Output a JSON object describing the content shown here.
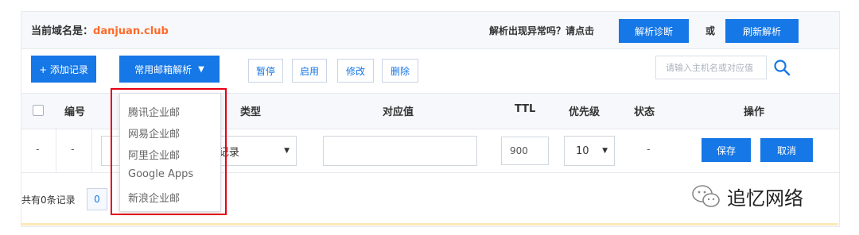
{
  "header": {
    "domain_label": "当前域名是：",
    "domain_name": "danjuan.club",
    "anomaly_text": "解析出现异常吗？请点击",
    "diagnose_button": "解析诊断",
    "or_text": "或",
    "refresh_button": "刷新解析"
  },
  "toolbar": {
    "add_record": "+ 添加记录",
    "mail_parse": "常用邮箱解析",
    "mail_parse_caret": "▼",
    "pause": "暂停",
    "enable": "启用",
    "modify": "修改",
    "delete": "删除",
    "search_placeholder": "请输入主机名或对应值"
  },
  "table": {
    "headers": {
      "number": "编号",
      "type": "类型",
      "value": "对应值",
      "ttl": "TTL",
      "priority": "优先级",
      "status": "状态",
      "actions": "操作"
    },
    "new_row": {
      "checkbox_placeholder": "-",
      "number_placeholder": "-",
      "type_value": "A记录",
      "type_caret": "▼",
      "ttl": "900",
      "priority": "10",
      "priority_caret": "▼",
      "status": "-",
      "save": "保存",
      "cancel": "取消"
    }
  },
  "footer": {
    "record_count": "共有0条记录",
    "page": "0"
  },
  "mail_dropdown": {
    "items": [
      "腾讯企业邮",
      "网易企业邮",
      "阿里企业邮",
      "Google Apps",
      "新浪企业邮"
    ]
  },
  "watermark": {
    "text": "追忆网络",
    "icon": "wechat-icon"
  },
  "colors": {
    "accent": "#1677e6",
    "domain": "#ff6a2a",
    "highlight": "#e60012"
  }
}
